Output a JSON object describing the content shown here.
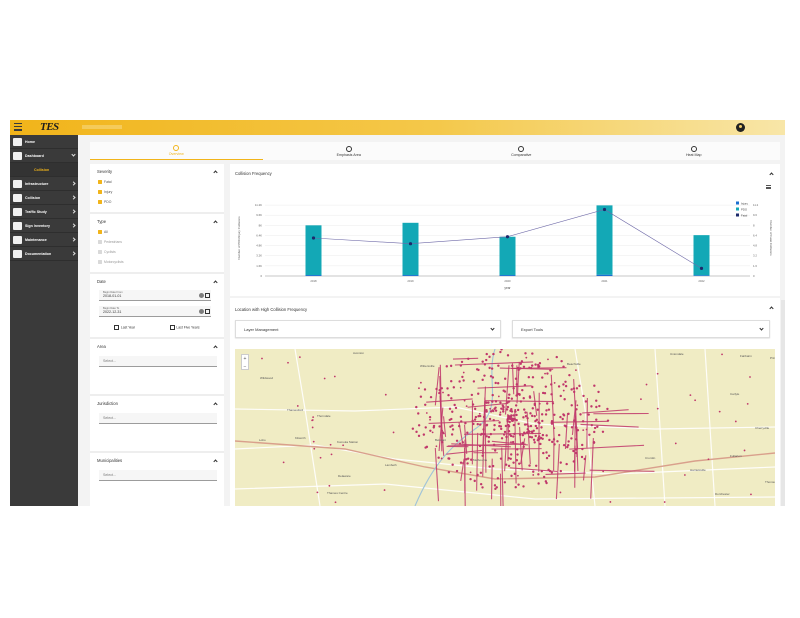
{
  "app": {
    "logo": "TES"
  },
  "sidebar": {
    "items": [
      {
        "label": "Home"
      },
      {
        "label": "Dashboard"
      },
      {
        "label": "Infrastructure"
      },
      {
        "label": "Collision"
      },
      {
        "label": "Traffic Study"
      },
      {
        "label": "Sign Inventory"
      },
      {
        "label": "Maintenance"
      },
      {
        "label": "Documentation"
      }
    ],
    "sub_item": "Collision"
  },
  "tabs": [
    {
      "label": "Overview"
    },
    {
      "label": "Emphasis Area"
    },
    {
      "label": "Comparative"
    },
    {
      "label": "Heat Map"
    }
  ],
  "filters": {
    "severity": {
      "title": "Severity",
      "options": [
        "Fatal",
        "Injury",
        "PDO"
      ]
    },
    "type": {
      "title": "Type",
      "options": [
        "All",
        "Pedestrians",
        "Cyclists",
        "Motorcyclists"
      ]
    },
    "date": {
      "title": "Date",
      "begin_label": "Begin Date From",
      "begin_value": "2018-01-01",
      "end_label": "Begin Date To",
      "end_value": "2022-12-31",
      "last_year": "Last Year",
      "last_five": "Last Five Years"
    },
    "area": {
      "title": "Area",
      "placeholder": "Select..."
    },
    "jurisdiction": {
      "title": "Jurisdiction",
      "placeholder": "Select..."
    },
    "municipalities": {
      "title": "Municipalities",
      "placeholder": "Select..."
    }
  },
  "chart_card": {
    "title": "Collision Frequency"
  },
  "chart_data": {
    "type": "bar",
    "categories": [
      "2018",
      "2019",
      "2020",
      "2021",
      "2022"
    ],
    "series": [
      {
        "name": "Injury",
        "values": [
          150,
          150,
          150,
          210,
          120
        ]
      },
      {
        "name": "PDO",
        "values": [
          7850,
          8250,
          6050,
          10940,
          6330
        ]
      },
      {
        "name": "Fatal",
        "values": [
          6,
          5.1,
          6.2,
          10.5,
          1.2
        ]
      }
    ],
    "xlabel": "year",
    "ylabel": "Number of PDO/Injury Collisions",
    "y2label": "Number of Fatal Collisions",
    "ylim": [
      0,
      12000
    ],
    "y2lim": [
      0,
      12
    ],
    "yticks": [
      "0",
      "1.6K",
      "3.2K",
      "4.8K",
      "6.4K",
      "8K",
      "9.6K",
      "11.2K"
    ],
    "y2ticks": [
      "0",
      "1.6",
      "3.2",
      "4.8",
      "6.4",
      "8",
      "9.6",
      "11.2"
    ],
    "grid": true,
    "legend": "top-right",
    "colors": {
      "Injury": "#1a6fd1",
      "PDO": "#13a8b6",
      "Fatal": "#1c2a6b"
    }
  },
  "map_card": {
    "title": "Location with High Collision Frequency",
    "layer_management": "Layer Management",
    "export_tools": "Export Tools",
    "zoom_in": "+",
    "zoom_out": "−",
    "places": [
      "Avonton",
      "Wittersville",
      "Wildwood",
      "Thorndale",
      "Thamesford",
      "Beachville",
      "Uniondale",
      "Fairbairn",
      "Prince Hill",
      "Lobo",
      "Kilworth",
      "Komoka Station",
      "Delaware",
      "Lambeth",
      "Thames Centre",
      "Belmont",
      "Melbourne",
      "Carlyle",
      "Crumlin",
      "Cherryville",
      "Fullarton",
      "Harrietsville",
      "Dorchester",
      "Thomson"
    ]
  },
  "colors": {
    "accent": "#f1b41a",
    "sidebar": "#3a3a3a",
    "map_bg": "#f0ecc4",
    "collision_points": "#c0386b"
  }
}
